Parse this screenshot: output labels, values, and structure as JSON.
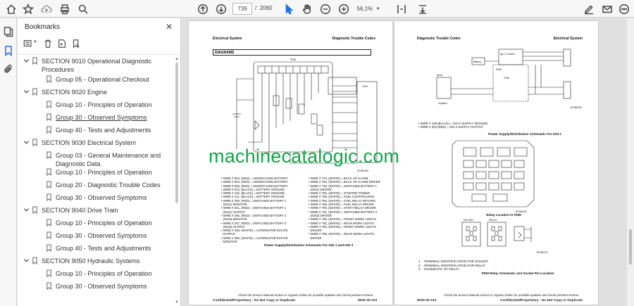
{
  "toolbar": {
    "current_page": "739",
    "page_separator": "/",
    "total_pages": "2060",
    "zoom": "56,1%"
  },
  "bookmarks": {
    "title": "Bookmarks",
    "items": [
      {
        "label": "SECTION 9010 Operational Diagnostic Procedures",
        "level": 0,
        "expanded": true
      },
      {
        "label": "Group 05 - Operational Checkout",
        "level": 1
      },
      {
        "label": "SECTION 9020 Engine",
        "level": 0,
        "expanded": true
      },
      {
        "label": "Group 10 - Principles of Operation",
        "level": 1
      },
      {
        "label": "Group 30 - Observed Symptoms",
        "level": 1,
        "underline": true
      },
      {
        "label": "Group 40 - Tests and Adjustments",
        "level": 1
      },
      {
        "label": "SECTION 9030 Electrical System",
        "level": 0,
        "expanded": true
      },
      {
        "label": "Group 03 - General Maintenance and Diagnostic Data",
        "level": 1
      },
      {
        "label": "Group 10 - Principles of Operation",
        "level": 1
      },
      {
        "label": "Group 20 - Diagnostic Trouble Codes",
        "level": 1
      },
      {
        "label": "Group 30 - Observed Symptoms",
        "level": 1
      },
      {
        "label": "SECTION 9040 Drive Train",
        "level": 0,
        "expanded": true
      },
      {
        "label": "Group 10 - Principles of Operation",
        "level": 1
      },
      {
        "label": "Group 30 - Observed Symptoms",
        "level": 1
      },
      {
        "label": "Group 40 - Tests and Adjustments",
        "level": 1
      },
      {
        "label": "SECTION 9050 Hydraulic Systems",
        "level": 0,
        "expanded": true
      },
      {
        "label": "Group 10 - Principles of Operation",
        "level": 1
      },
      {
        "label": "Group 30 - Observed Symptoms",
        "level": 1
      }
    ]
  },
  "left_page": {
    "header_left": "Electrical System",
    "header_right": "Diagnostic Trouble Codes",
    "section_header": "DIAGRAMS",
    "pdm_label": "PDM",
    "vsm_label": "VSM",
    "diagram_code": "BT88/250",
    "wires_col1": [
      "• WIRE # 003, (RED) = UNSWITCHED BATTERY",
      "• WIRE # 004, (RED) = UNSWITCHED BATTERY",
      "• WIRE # 005, (RED) = UNSWITCHED BATTERY",
      "• WIRE # 013, (BLACK) = BATTERY GROUND",
      "• WIRE # 120, (BLACK) = BATTERY GROUND",
      "• WIRE # 121, (BLACK) = BATTERY GROUND",
      "• WIRE # 200, (RED) = SWITCHED BATTERY 1",
      "  (IGN1) MONITOR",
      "• WIRE # 201, (RED) = SWITCHED BATTERY 1",
      "  (IGN1) OUTPUT",
      "• WIRE # 206, (RED) = SWITCHED BATTERY 3",
      "  (IGN3) MONITOR",
      "• WIRE # 207, (RED) = SWITCHED BATTERY 3",
      "  (IGN3) OUTPUT",
      "• WIRE # 349, (WHITE) = ALTERNATOR EXCITE",
      "  OUTPUT",
      "• WIRE # 350, (WHITE) = ALTERNATOR EXCITE",
      "  MONITOR"
    ],
    "wires_col2": [
      "• WIRE # 724, (WHITE) = BACK UP ALARM",
      "• WIRE # 726, (WHITE) = BACK UP ALARM DRIVER",
      "• WIRE # 729, (WHITE) = SWITCHED BATTERY 1",
      "  (IGN1) DRIVER",
      "• WIRE # 750, (WHITE) = STARTER POWER",
      "• WIRE # 756, (WHITE) = FUEL CONTROL/RUN",
      "• WIRE # 758, (WHITE) = FUEL RELAY RETURN",
      "• WIRE # 759, (WHITE) = FUEL RELAY DRIVER",
      "• WIRE # 760, (WHITE) = START RELAY DRIVER",
      "• WIRE # 761, (WHITE) = SWITCHED BATTERY 3",
      "  (IGN3) DRIVER",
      "• WIRE # 780, (WHITE) = FRONT WORK LIGHTS",
      "• WIRE # 781, (WHITE) = REAR WORK LIGHTS",
      "• WIRE # 783, (WHITE) = FRONT WORK LIGHTS",
      "  DRIVER",
      "• WIRE # 785, (WHITE) = REAR WORK LIGHTS",
      "  DRIVER"
    ],
    "caption": "Power Supply/Distribution Schematic For IGN 1 and IGN 3",
    "footer_note": "Check the Service Manual section in Hypass Online for possible updates and check pertinent Grams.",
    "footer_left": "Confidential/Proprietary - Do Not Copy or Duplicate",
    "footer_right": "9030-20-213"
  },
  "right_page": {
    "header_left": "Diagnostic Trouble Codes",
    "header_right": "Electrical System",
    "ign_box": "Ign 2 Control",
    "battery_label": "Battery",
    "pdm_label": "PDM",
    "vsm_label": "VSM",
    "mlm_label": "MLM",
    "joystick_label": "Joystick",
    "diagram_code_1": "BT88/226",
    "wires": [
      "• WIRE # 109 (BLACK) = IGN 2 SUPPLY GROUND",
      "• WIRE # 203 (RED) = IGN 2 SUPPLY OUTPUT"
    ],
    "caption_1": "Power Supply/Distribution Schematic For IGN 2",
    "diagram_code_2": "BT88/225",
    "relay_caption": "Relay Location in PDM",
    "socket_label": "SOCKET",
    "relay_label": "RELAY",
    "diagram_code_3": "BT88/274",
    "legend": [
      "1    TERMINAL IDENTIFICATION FOR SOCKET",
      "2    TERMINAL IDENTIFICATION FOR RELAY",
      "3    SCHEMATIC OF RELAY"
    ],
    "caption_2": "PDM Relay Schematic and Socket Pin Location",
    "footer_note": "Check the Service Manual section in Hypass Online for possible updates and check pertinent Grams.",
    "footer_left": "9030-20-214",
    "footer_right": "Confidential/Proprietary - Do Not Copy or Duplicate"
  },
  "watermark": "machinecatalogic.com",
  "icons": [
    "home-icon",
    "star-icon",
    "cloud-upload-icon",
    "print-icon",
    "search-icon",
    "arrow-up-icon",
    "arrow-down-icon",
    "cursor-icon",
    "hand-icon",
    "zoom-out-icon",
    "zoom-in-icon",
    "text-select-icon",
    "download-icon",
    "sign-icon",
    "mail-icon",
    "more-icon"
  ]
}
